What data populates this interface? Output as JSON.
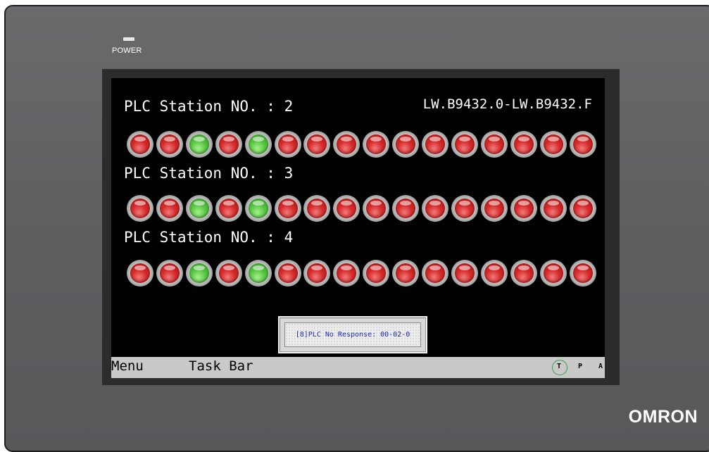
{
  "device": {
    "power_label": "POWER",
    "brand": "OMRON"
  },
  "stations": [
    {
      "title": "PLC Station NO. : 2",
      "leds": [
        0,
        0,
        1,
        0,
        1,
        0,
        0,
        0,
        0,
        0,
        0,
        0,
        0,
        0,
        0,
        0
      ]
    },
    {
      "title": "PLC Station NO. : 3",
      "leds": [
        0,
        0,
        1,
        0,
        1,
        0,
        0,
        0,
        0,
        0,
        0,
        0,
        0,
        0,
        0,
        0
      ]
    },
    {
      "title": "PLC Station NO. : 4",
      "leds": [
        0,
        0,
        1,
        0,
        1,
        0,
        0,
        0,
        0,
        0,
        0,
        0,
        0,
        0,
        0,
        0
      ]
    }
  ],
  "address_range": "LW.B9432.0-LW.B9432.F",
  "alarm": {
    "message": "[8]PLC No Response: 00-02-0"
  },
  "taskbar": {
    "menu": "Menu",
    "task_bar": "Task Bar",
    "indicators": [
      "T",
      "P",
      "A"
    ]
  },
  "colors": {
    "led_on": "#5cc946",
    "led_off": "#d72c2c",
    "alarm_text": "#1d2aa8",
    "active_indicator_ring": "#2fa24a"
  }
}
